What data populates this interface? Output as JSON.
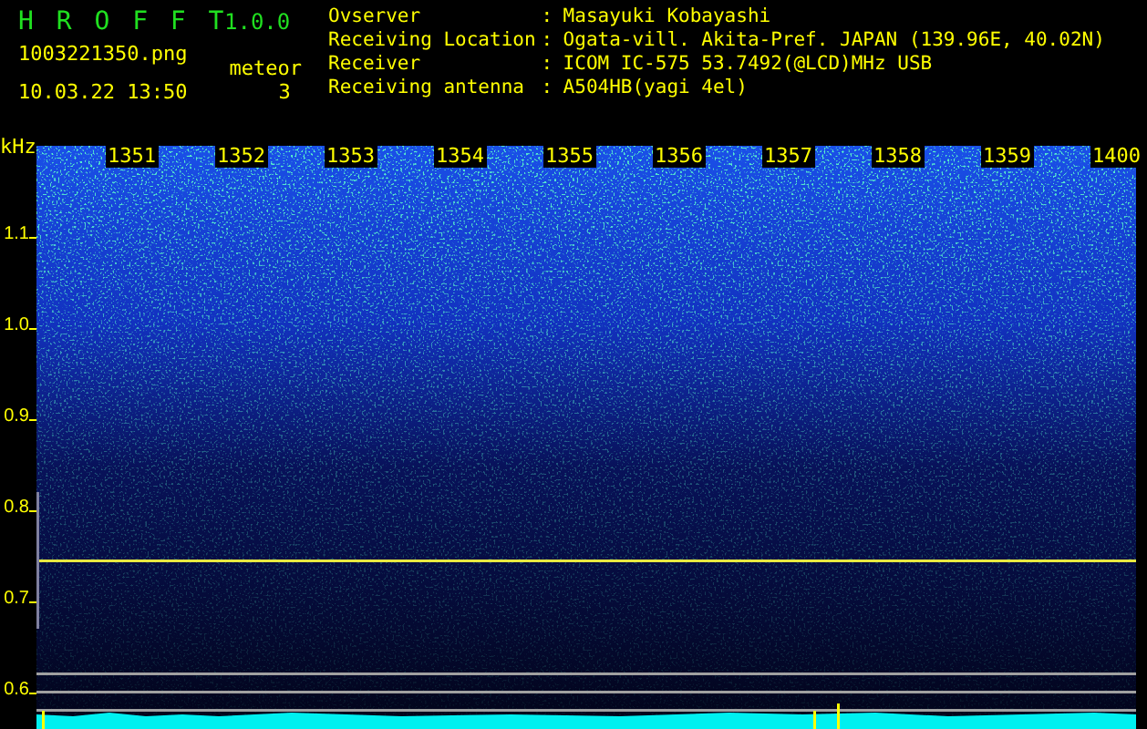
{
  "app": {
    "name": "H R O F F T",
    "version": "1.0.0"
  },
  "file_name": "1003221350.png",
  "timestamp": "10.03.22 13:50",
  "meteor_counter": {
    "label": "meteor",
    "count": "3"
  },
  "station_info": [
    {
      "label": "Ovserver",
      "separator": ":",
      "value": "Masayuki Kobayashi"
    },
    {
      "label": "Receiving Location",
      "separator": ":",
      "value": "Ogata-vill. Akita-Pref. JAPAN (139.96E, 40.02N)"
    },
    {
      "label": "Receiver",
      "separator": ":",
      "value": "ICOM IC-575 53.7492(@LCD)MHz USB"
    },
    {
      "label": "Receiving antenna",
      "separator": ":",
      "value": "A504HB(yagi 4el)"
    }
  ],
  "spectrogram": {
    "y_unit": "kHz",
    "y_labels": [
      "1.1",
      "1.0",
      "0.9",
      "0.8",
      "0.7",
      "0.6"
    ],
    "time_labels": [
      "1351",
      "1352",
      "1353",
      "1354",
      "1355",
      "1356",
      "1357",
      "1358",
      "1359",
      "1400"
    ]
  }
}
